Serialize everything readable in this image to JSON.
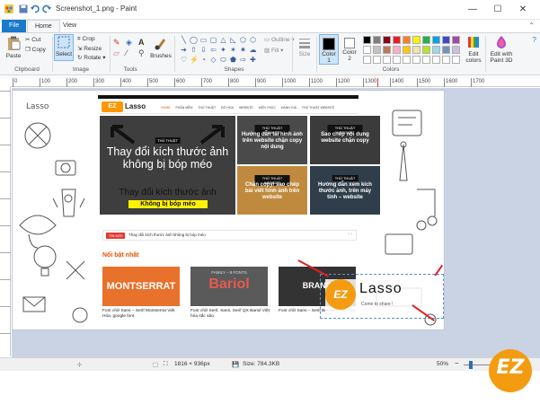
{
  "window": {
    "title": "Screenshot_1.png - Paint",
    "controls": {
      "minimize": "—",
      "maximize": "☐",
      "close": "✕"
    }
  },
  "tabs": {
    "file": "File",
    "home": "Home",
    "view": "View"
  },
  "ribbon": {
    "paste": "Paste",
    "cut": "Cut",
    "copy": "Copy",
    "clipboard": "Clipboard",
    "select": "Select",
    "crop": "Crop",
    "resize": "Resize",
    "rotate": "Rotate",
    "image": "Image",
    "tools": "Tools",
    "brushes": "Brushes",
    "outline": "Outline",
    "fill": "Fill",
    "shapes": "Shapes",
    "size": "Size",
    "color1": "Color 1",
    "color2": "Color 2",
    "colors": "Colors",
    "edit_colors": "Edit colors",
    "edit_paint3d": "Edit with Paint 3D",
    "palette_row1": [
      "#000000",
      "#7f7f7f",
      "#880015",
      "#ed1c24",
      "#ff7f27",
      "#fff200",
      "#22b14c",
      "#00a2e8",
      "#3f48cc",
      "#a349a4"
    ],
    "palette_row2": [
      "#ffffff",
      "#c3c3c3",
      "#b97a57",
      "#ffaec9",
      "#ffc90e",
      "#efe4b0",
      "#b5e61d",
      "#99d9ea",
      "#7092be",
      "#c8bfe7"
    ]
  },
  "ruler": {
    "ticks": [
      "0",
      "100",
      "200",
      "300",
      "400",
      "500",
      "600",
      "700",
      "800",
      "900",
      "1000",
      "1100",
      "1200",
      "1300",
      "1400",
      "1500",
      "1600",
      "1700"
    ]
  },
  "status": {
    "dimensions": "1816 × 936px",
    "size": "Size: 784.3KB",
    "zoom": "50%"
  },
  "image": {
    "top_logo": "Lasso",
    "nav_items": [
      "HOME",
      "PHẦN MỀM",
      "THỦ THUẬT",
      "ĐỒ HỌA",
      "WEBSITE",
      "KIẾN THỨC",
      "ĐÁNH GIÁ",
      "THỦ THUẬT WEBSITE"
    ],
    "hero_title": "Thay đổi kích thước ảnh không bị bóp méo",
    "hero_sub1": "Thay đổi kích thước ảnh",
    "hero_sub2": "Không bị bóp méo",
    "hero_tag": "THỦ THUẬT",
    "tiles": [
      {
        "tag": "THỦ THUẬT WEBSITE",
        "text": "Hướng dẫn tải hình ảnh trên website chặn copy nội dung",
        "bg": "#4a4a4a"
      },
      {
        "tag": "THỦ THUẬT WEBSITE",
        "text": "Sao chép nội dung website chặn copy",
        "bg": "#3b3b3b"
      },
      {
        "tag": "THỦ THUẬT WEBSITE",
        "text": "Chặn copy/ sao chép bài viết hình ảnh trên website",
        "bg": "#c08a3e"
      },
      {
        "tag": "THỦ THUẬT",
        "text": "Hướng dẫn xem kích thước ảnh, trên máy tính – website",
        "bg": "#2f3e4a"
      }
    ],
    "ticker_tag": "TIN MỚI",
    "ticker_text": "Thay đổi kích thước ảnh không bị bóp méo",
    "featured_heading": "Nổi bật nhất",
    "cards": [
      {
        "img_text": "MONTSERRAT",
        "caption": "Font chữ Sans – Serif Montserrat Việt Hóa, google font"
      },
      {
        "img_text": "Bariol",
        "img_top": "FAMILY – 8 FONTS",
        "caption": "Font chữ Serif, Sans, Serif QX Bariol Việt hóa sắc sảo"
      },
      {
        "img_text": "BRAND",
        "caption": "Font chữ Sans – Serif Brandon Việt hóa"
      }
    ],
    "watermark_logo": "Lasso",
    "watermark_tagline": "Come to share !",
    "corner_logo": "EZ"
  }
}
